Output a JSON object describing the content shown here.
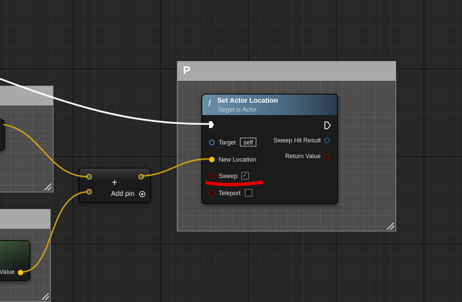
{
  "comment_box": {
    "title": "P"
  },
  "set_actor_location": {
    "func_icon": "ƒ",
    "title": "Set Actor Location",
    "subtitle": "Target is Actor",
    "pins": {
      "target": "Target",
      "target_default": "self",
      "new_location": "New Location",
      "sweep": "Sweep",
      "sweep_checked": true,
      "teleport": "Teleport",
      "teleport_checked": false,
      "sweep_hit_result": "Sweep Hit Result",
      "return_value": "Return Value"
    }
  },
  "make_array_node": {
    "plus_icon": "+",
    "add_pin_label": "Add pin"
  },
  "left_node": {
    "value_label": "Value"
  },
  "colors": {
    "vector_pin": "#f3c618",
    "exec_wire": "#ffffff",
    "bool_pin": "#8b0000",
    "struct_pin": "#2a6fb5",
    "annotation": "#e00000"
  }
}
